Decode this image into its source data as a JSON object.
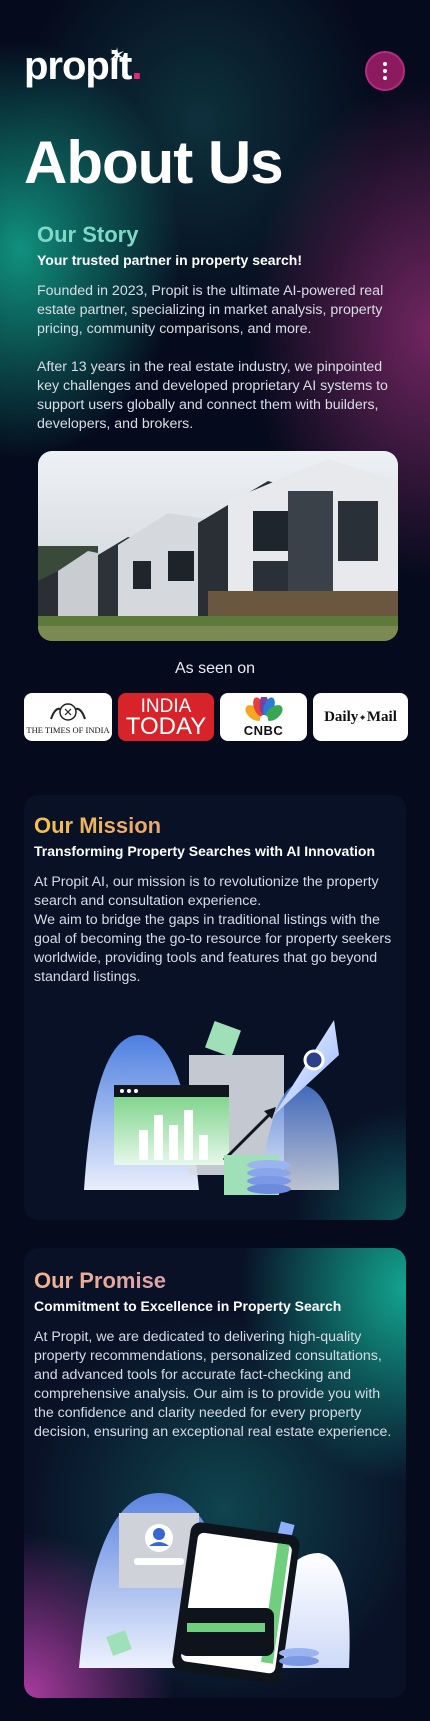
{
  "brand": {
    "name": "propit",
    "dot": ".",
    "accent": "#e4287a"
  },
  "header": {
    "menu_icon": "more-vertical-icon"
  },
  "page_title": "About Us",
  "story": {
    "heading": "Our Story",
    "subheading": "Your trusted partner in property search!",
    "paragraphs": [
      "Founded in 2023, Propit is the ultimate AI-powered real estate partner, specializing in market analysis, property pricing, community comparisons, and more.",
      "After 13 years in the real estate industry, we pinpointed key challenges and developed proprietary AI systems to support users globally and connect them with builders, developers, and brokers."
    ]
  },
  "press": {
    "label": "As seen on",
    "logos": [
      {
        "name": "THE TIMES OF INDIA"
      },
      {
        "name_top": "INDIA",
        "name_bottom": "TODAY"
      },
      {
        "name": "CNBC"
      },
      {
        "name_left": "Daily",
        "name_mid": "Mail"
      }
    ]
  },
  "mission": {
    "heading": "Our Mission",
    "subheading": "Transforming Property Searches with AI Innovation",
    "paragraph_1": "At Propit AI, our mission is to revolutionize the property search and consultation experience.",
    "paragraph_2": "We aim to bridge the gaps in traditional listings with the goal of becoming the go-to resource for property seekers worldwide, providing tools and features that go beyond standard listings."
  },
  "promise": {
    "heading": "Our Promise",
    "subheading": "Commitment to Excellence in Property Search",
    "paragraph": "At Propit, we are dedicated to delivering high-quality property recommendations, personalized consultations, and advanced tools for accurate fact-checking and comprehensive analysis. Our aim is to provide you with the confidence and clarity needed for every property decision, ensuring an exceptional real estate experience."
  }
}
